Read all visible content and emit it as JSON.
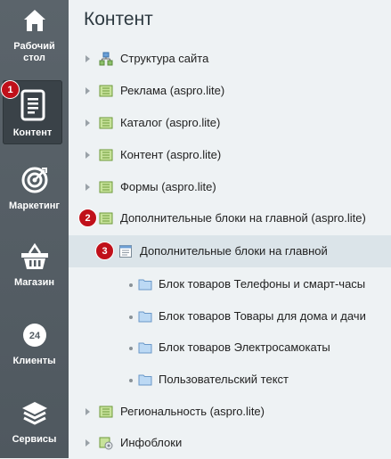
{
  "sidebar": {
    "items": [
      {
        "label_line1": "Рабочий",
        "label_line2": "стол",
        "icon": "home-icon"
      },
      {
        "label": "Контент",
        "icon": "document-icon",
        "badge": "1"
      },
      {
        "label": "Маркетинг",
        "icon": "target-icon"
      },
      {
        "label": "Магазин",
        "icon": "basket-icon"
      },
      {
        "label": "Клиенты",
        "icon": "clients-icon",
        "icon_text": "24"
      },
      {
        "label": "Сервисы",
        "icon": "layers-icon"
      }
    ]
  },
  "main": {
    "title": "Контент",
    "tree": [
      {
        "label": "Структура сайта",
        "icon": "sitemap-icon"
      },
      {
        "label": "Реклама (aspro.lite)",
        "icon": "iblock-icon"
      },
      {
        "label": "Каталог (aspro.lite)",
        "icon": "iblock-icon"
      },
      {
        "label": "Контент (aspro.lite)",
        "icon": "iblock-icon"
      },
      {
        "label": "Формы (aspro.lite)",
        "icon": "iblock-icon"
      },
      {
        "label": "Дополнительные блоки на главной (aspro.lite)",
        "icon": "iblock-icon",
        "badge": "2"
      },
      {
        "label": "Дополнительные блоки на главной",
        "icon": "list-icon",
        "badge": "3"
      },
      {
        "label": "Блок товаров Телефоны и смарт-часы",
        "icon": "folder-icon"
      },
      {
        "label": "Блок товаров Товары для дома и дачи",
        "icon": "folder-icon"
      },
      {
        "label": "Блок товаров Электросамокаты",
        "icon": "folder-icon"
      },
      {
        "label": "Пользовательский текст",
        "icon": "folder-icon"
      },
      {
        "label": "Региональность (aspro.lite)",
        "icon": "iblock-icon"
      },
      {
        "label": "Инфоблоки",
        "icon": "iblocks-gear-icon"
      }
    ]
  },
  "colors": {
    "sidebar_bg": "#545d64",
    "badge": "#c0101a",
    "selected_row": "#dbe4e9",
    "content_bg": "#eef2f4"
  }
}
